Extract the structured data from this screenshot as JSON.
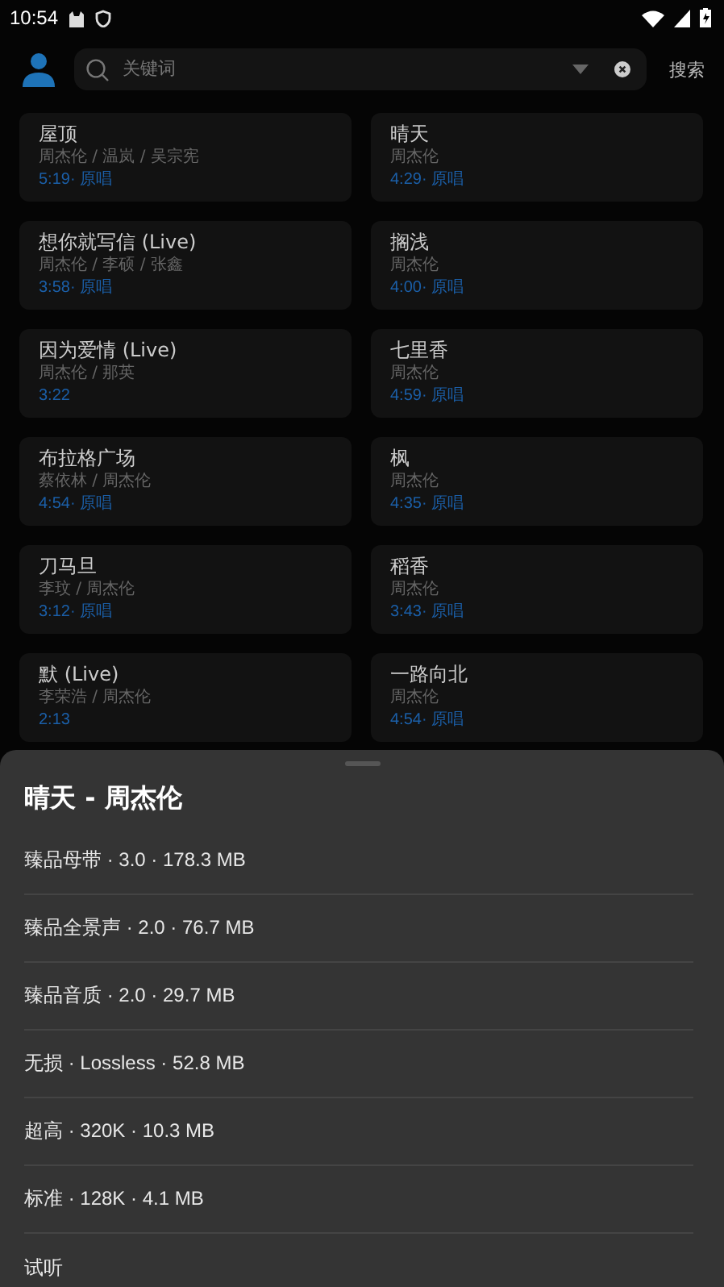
{
  "status_bar": {
    "time": "10:54"
  },
  "search": {
    "placeholder": "关键词",
    "button": "搜索"
  },
  "songs": [
    {
      "title": "屋顶",
      "artists": "周杰伦 / 温岚 / 吴宗宪",
      "duration": "5:19",
      "tag": "· 原唱"
    },
    {
      "title": "晴天",
      "artists": "周杰伦",
      "duration": "4:29",
      "tag": "· 原唱"
    },
    {
      "title": "想你就写信 (Live)",
      "artists": "周杰伦 / 李硕 / 张鑫",
      "duration": "3:58",
      "tag": "· 原唱"
    },
    {
      "title": "搁浅",
      "artists": "周杰伦",
      "duration": "4:00",
      "tag": "· 原唱"
    },
    {
      "title": "因为爱情 (Live)",
      "artists": "周杰伦 / 那英",
      "duration": "3:22"
    },
    {
      "title": "七里香",
      "artists": "周杰伦",
      "duration": "4:59",
      "tag": "· 原唱"
    },
    {
      "title": "布拉格广场",
      "artists": "蔡依林 / 周杰伦",
      "duration": "4:54",
      "tag": "· 原唱"
    },
    {
      "title": "枫",
      "artists": "周杰伦",
      "duration": "4:35",
      "tag": "· 原唱"
    },
    {
      "title": "刀马旦",
      "artists": "李玟 / 周杰伦",
      "duration": "3:12",
      "tag": "· 原唱"
    },
    {
      "title": "稻香",
      "artists": "周杰伦",
      "duration": "3:43",
      "tag": "· 原唱"
    },
    {
      "title": "默 (Live)",
      "artists": "李荣浩 / 周杰伦",
      "duration": "2:13"
    },
    {
      "title": "一路向北",
      "artists": "周杰伦",
      "duration": "4:54",
      "tag": "· 原唱"
    }
  ],
  "sheet": {
    "title": "晴天 - 周杰伦",
    "options": [
      "臻品母带 · 3.0 · 178.3 MB",
      "臻品全景声 · 2.0 · 76.7 MB",
      "臻品音质 · 2.0 · 29.7 MB",
      "无损 · Lossless · 52.8 MB",
      "超高 · 320K · 10.3 MB",
      "标准 · 128K · 4.1 MB",
      "试听"
    ]
  }
}
